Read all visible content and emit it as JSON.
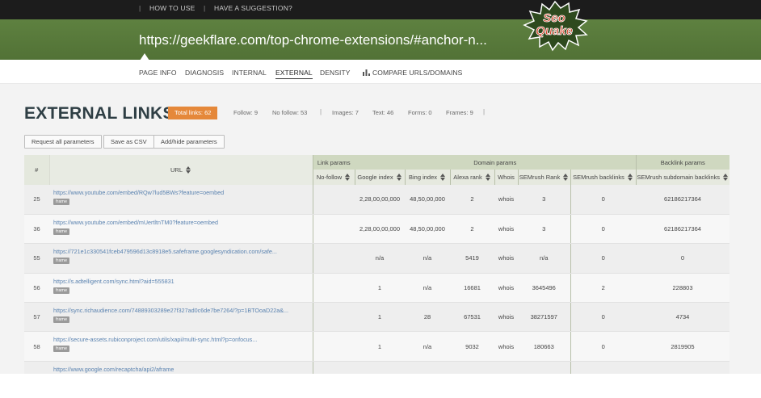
{
  "topbar": {
    "how_to_use": "HOW TO USE",
    "suggestion": "HAVE A SUGGESTION?"
  },
  "banner": {
    "url": "https://geekflare.com/top-chrome-extensions/#anchor-n..."
  },
  "logo": {
    "line1": "Seo",
    "line2": "Quake"
  },
  "nav": {
    "tabs": [
      "PAGE INFO",
      "DIAGNOSIS",
      "INTERNAL",
      "EXTERNAL",
      "DENSITY",
      "COMPARE URLS/DOMAINS"
    ],
    "active": "EXTERNAL"
  },
  "page": {
    "title": "EXTERNAL LINKS",
    "badge": "Total links: 62",
    "stats": [
      "Follow: 9",
      "No follow: 53",
      "Images: 7",
      "Text: 46",
      "Forms: 0",
      "Frames: 9"
    ],
    "buttons": [
      "Request all parameters",
      "Save as CSV",
      "Add/hide parameters"
    ]
  },
  "table": {
    "group_headers": {
      "link": "Link params",
      "domain": "Domain params",
      "backlink": "Backlink params"
    },
    "columns": {
      "num": "#",
      "url": "URL",
      "nofollow": "No-follow",
      "google": "Google index",
      "bing": "Bing index",
      "alexa": "Alexa rank",
      "whois": "Whois",
      "semrush_rank": "SEMrush Rank",
      "semrush_backlinks": "SEMrush backlinks",
      "semrush_subdomain": "SEMrush subdomain backlinks"
    },
    "rows": [
      {
        "num": "25",
        "url": "https://www.youtube.com/embed/RQw7lud5BWs?feature=oembed",
        "tag": "frame",
        "nofollow": "",
        "google": "2,28,00,00,000",
        "bing": "48,50,00,000",
        "alexa": "2",
        "whois": "whois",
        "semrush_rank": "3",
        "semrush_backlinks": "0",
        "semrush_subdomain": "62186217364"
      },
      {
        "num": "36",
        "url": "https://www.youtube.com/embed/mUertltnTM0?feature=oembed",
        "tag": "frame",
        "nofollow": "",
        "google": "2,28,00,00,000",
        "bing": "48,50,00,000",
        "alexa": "2",
        "whois": "whois",
        "semrush_rank": "3",
        "semrush_backlinks": "0",
        "semrush_subdomain": "62186217364"
      },
      {
        "num": "55",
        "url": "https://721e1c330541fceb479596d13c8918e5.safeframe.googlesyndication.com/safe...",
        "tag": "frame",
        "nofollow": "",
        "google": "n/a",
        "bing": "n/a",
        "alexa": "5419",
        "whois": "whois",
        "semrush_rank": "n/a",
        "semrush_backlinks": "0",
        "semrush_subdomain": "0"
      },
      {
        "num": "56",
        "url": "https://s.adtelligent.com/sync.html?aid=555831",
        "tag": "frame",
        "nofollow": "",
        "google": "1",
        "bing": "n/a",
        "alexa": "16681",
        "whois": "whois",
        "semrush_rank": "3645496",
        "semrush_backlinks": "2",
        "semrush_subdomain": "228803"
      },
      {
        "num": "57",
        "url": "https://sync.richaudience.com/74889303289e27f327ad0c6de7be7264/?p=1BTOoaD22a&...",
        "tag": "frame",
        "nofollow": "",
        "google": "1",
        "bing": "28",
        "alexa": "67531",
        "whois": "whois",
        "semrush_rank": "38271597",
        "semrush_backlinks": "0",
        "semrush_subdomain": "4734"
      },
      {
        "num": "58",
        "url": "https://secure-assets.rubiconproject.com/utils/xapi/multi-sync.html?p=onfocus...",
        "tag": "frame",
        "nofollow": "",
        "google": "1",
        "bing": "n/a",
        "alexa": "9032",
        "whois": "whois",
        "semrush_rank": "180663",
        "semrush_backlinks": "0",
        "semrush_subdomain": "2819905"
      },
      {
        "num": "",
        "url": "https://www.google.com/recaptcha/api2/aframe",
        "tag": "",
        "nofollow": "",
        "google": "",
        "bing": "",
        "alexa": "",
        "whois": "",
        "semrush_rank": "",
        "semrush_backlinks": "",
        "semrush_subdomain": ""
      }
    ]
  }
}
